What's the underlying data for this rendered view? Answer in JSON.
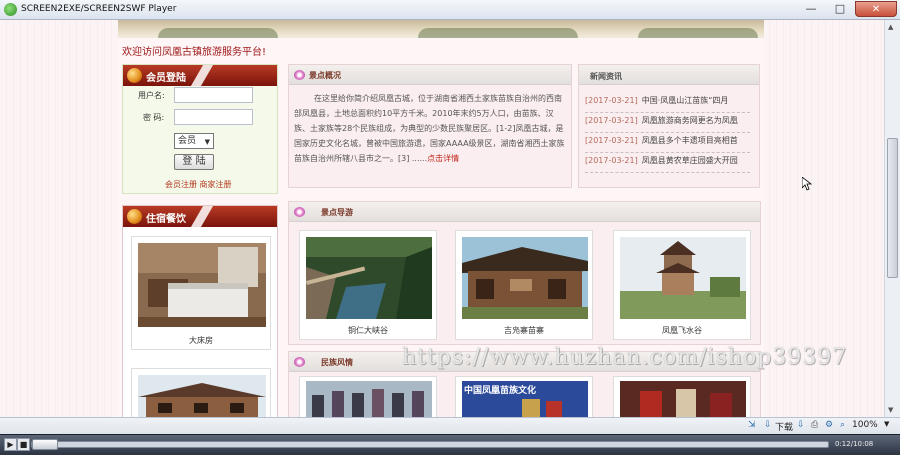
{
  "window": {
    "title": "SCREEN2EXE/SCREEN2SWF Player",
    "min": "—",
    "max": "□",
    "close": "✕"
  },
  "site": {
    "welcome": "欢迎访问凤凰古镇旅游服务平台!",
    "login": {
      "title": "会员登陆",
      "username_label": "用户名:",
      "password_label": "密 码:",
      "role_selected": "会员",
      "submit": "登 陆",
      "register_member": "会员注册",
      "register_merchant": "商家注册"
    },
    "lodging": {
      "title": "住宿餐饮",
      "items": [
        {
          "caption": "大床房"
        },
        {
          "caption": ""
        }
      ]
    },
    "intro": {
      "title": "景点概况",
      "text": "在这里给你简介绍凤凰古城，位于湖南省湘西土家族苗族自治州的西南部凤凰县，土地总面积约10平方千米。2010年末约5万人口，由苗族、汉族、土家族等28个民族组成，为典型的少数民族聚居区。[1-2]凤凰古城，是国家历史文化名城，曾被中国旅游遗，国家AAAA级景区，湖南省湘西土家族苗族自治州所辖八县市之一。[3] ......",
      "more": "点击详情"
    },
    "news": {
      "title": "新闻资讯",
      "items": [
        {
          "date": "[2017-03-21]",
          "title": "中国·凤凰山江苗族“四月"
        },
        {
          "date": "[2017-03-21]",
          "title": "凤凰旅游商务网更名为凤凰"
        },
        {
          "date": "[2017-03-21]",
          "title": "凤凰县多个丰遗项目亮相首"
        },
        {
          "date": "[2017-03-21]",
          "title": "凤凰县黄农草庄园盛大开园"
        }
      ]
    },
    "guide": {
      "title": "景点导游",
      "items": [
        {
          "caption": "铜仁大峡谷"
        },
        {
          "caption": "吉凫寨苗寨"
        },
        {
          "caption": "凤凰飞水谷"
        }
      ]
    },
    "culture": {
      "title": "民族风情",
      "banner_text": "中国凤凰苗族文化"
    }
  },
  "statusbar": {
    "download": "下载",
    "zoom": "100%"
  },
  "player": {
    "time": "0:12/10:08"
  },
  "watermark": "https://www.huzhan.com/ishop39397"
}
